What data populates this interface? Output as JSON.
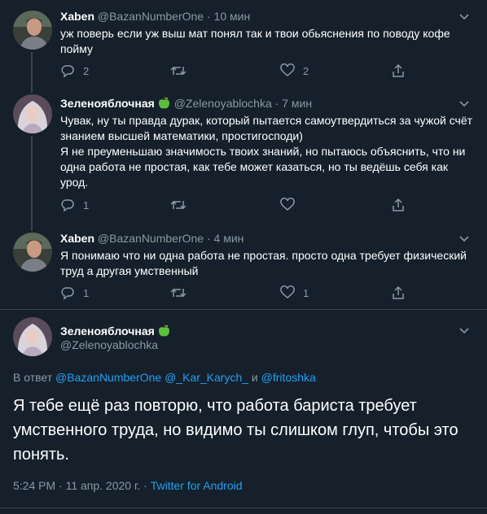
{
  "colors": {
    "background": "#15202b",
    "text_primary": "#ffffff",
    "text_secondary": "#8899a6",
    "link": "#1da1f2",
    "divider": "#38444d"
  },
  "tweets": [
    {
      "name": "Xaben",
      "handle": "@BazanNumberOne",
      "separator": "·",
      "time": "10 мин",
      "text": "уж поверь если уж выш мат понял так и твои обьяснения по поводу кофе пойму",
      "reply_count": "2",
      "retweet_count": "",
      "like_count": "2"
    },
    {
      "name": "Зеленояблочная",
      "name_icon": "green-apple-icon",
      "handle": "@Zelenoyablochka",
      "separator": "·",
      "time": "7 мин",
      "text_line1": "Чувак, ну ты правда дурак, который пытается самоутвердиться за чужой счёт знанием высшей математики, простигосподи)",
      "text_line2": "Я не преуменьшаю значимость твоих знаний, но пытаюсь объяснить, что ни одна работа не простая, как тебе может казаться, но ты ведёшь себя как урод.",
      "reply_count": "1",
      "retweet_count": "",
      "like_count": ""
    },
    {
      "name": "Xaben",
      "handle": "@BazanNumberOne",
      "separator": "·",
      "time": "4 мин",
      "text": "Я понимаю что ни одна работа не простая. просто одна требует физический труд а другая умственный",
      "reply_count": "1",
      "retweet_count": "",
      "like_count": "1"
    }
  ],
  "main_tweet": {
    "name": "Зеленояблочная",
    "name_icon": "green-apple-icon",
    "handle": "@Zelenoyablochka",
    "reply_prefix": "В ответ",
    "mention1": "@BazanNumberOne",
    "mention2": "@_Kar_Karych_",
    "conjunction": "и",
    "mention3": "@fritoshka",
    "text": "Я тебе ещё раз повторю, что работа бариста требует умственного труда, но видимо ты слишком глуп, чтобы это понять.",
    "timestamp": "5:24 PM · 11 апр. 2020 г. ·",
    "source": "Twitter for Android"
  }
}
